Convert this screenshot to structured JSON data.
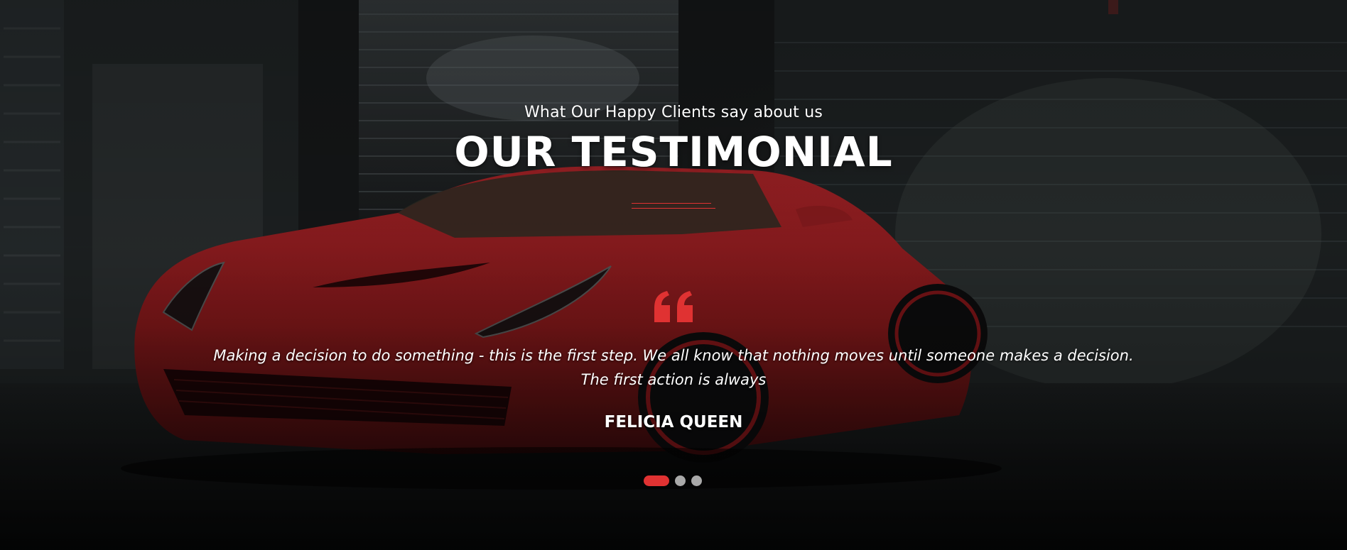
{
  "testimonial": {
    "subtitle": "What Our Happy Clients say about us",
    "title": "OUR TESTIMONIAL",
    "quote": "Making a decision to do something - this is the first step. We all know that nothing moves until someone makes a decision. The first action is always",
    "client_name": "FELICIA QUEEN",
    "quote_icon": "quote-icon",
    "slides_total": 3,
    "active_slide": 1
  },
  "colors": {
    "accent": "#e03232",
    "text": "#ffffff",
    "dot_inactive": "#a9a9a9"
  }
}
